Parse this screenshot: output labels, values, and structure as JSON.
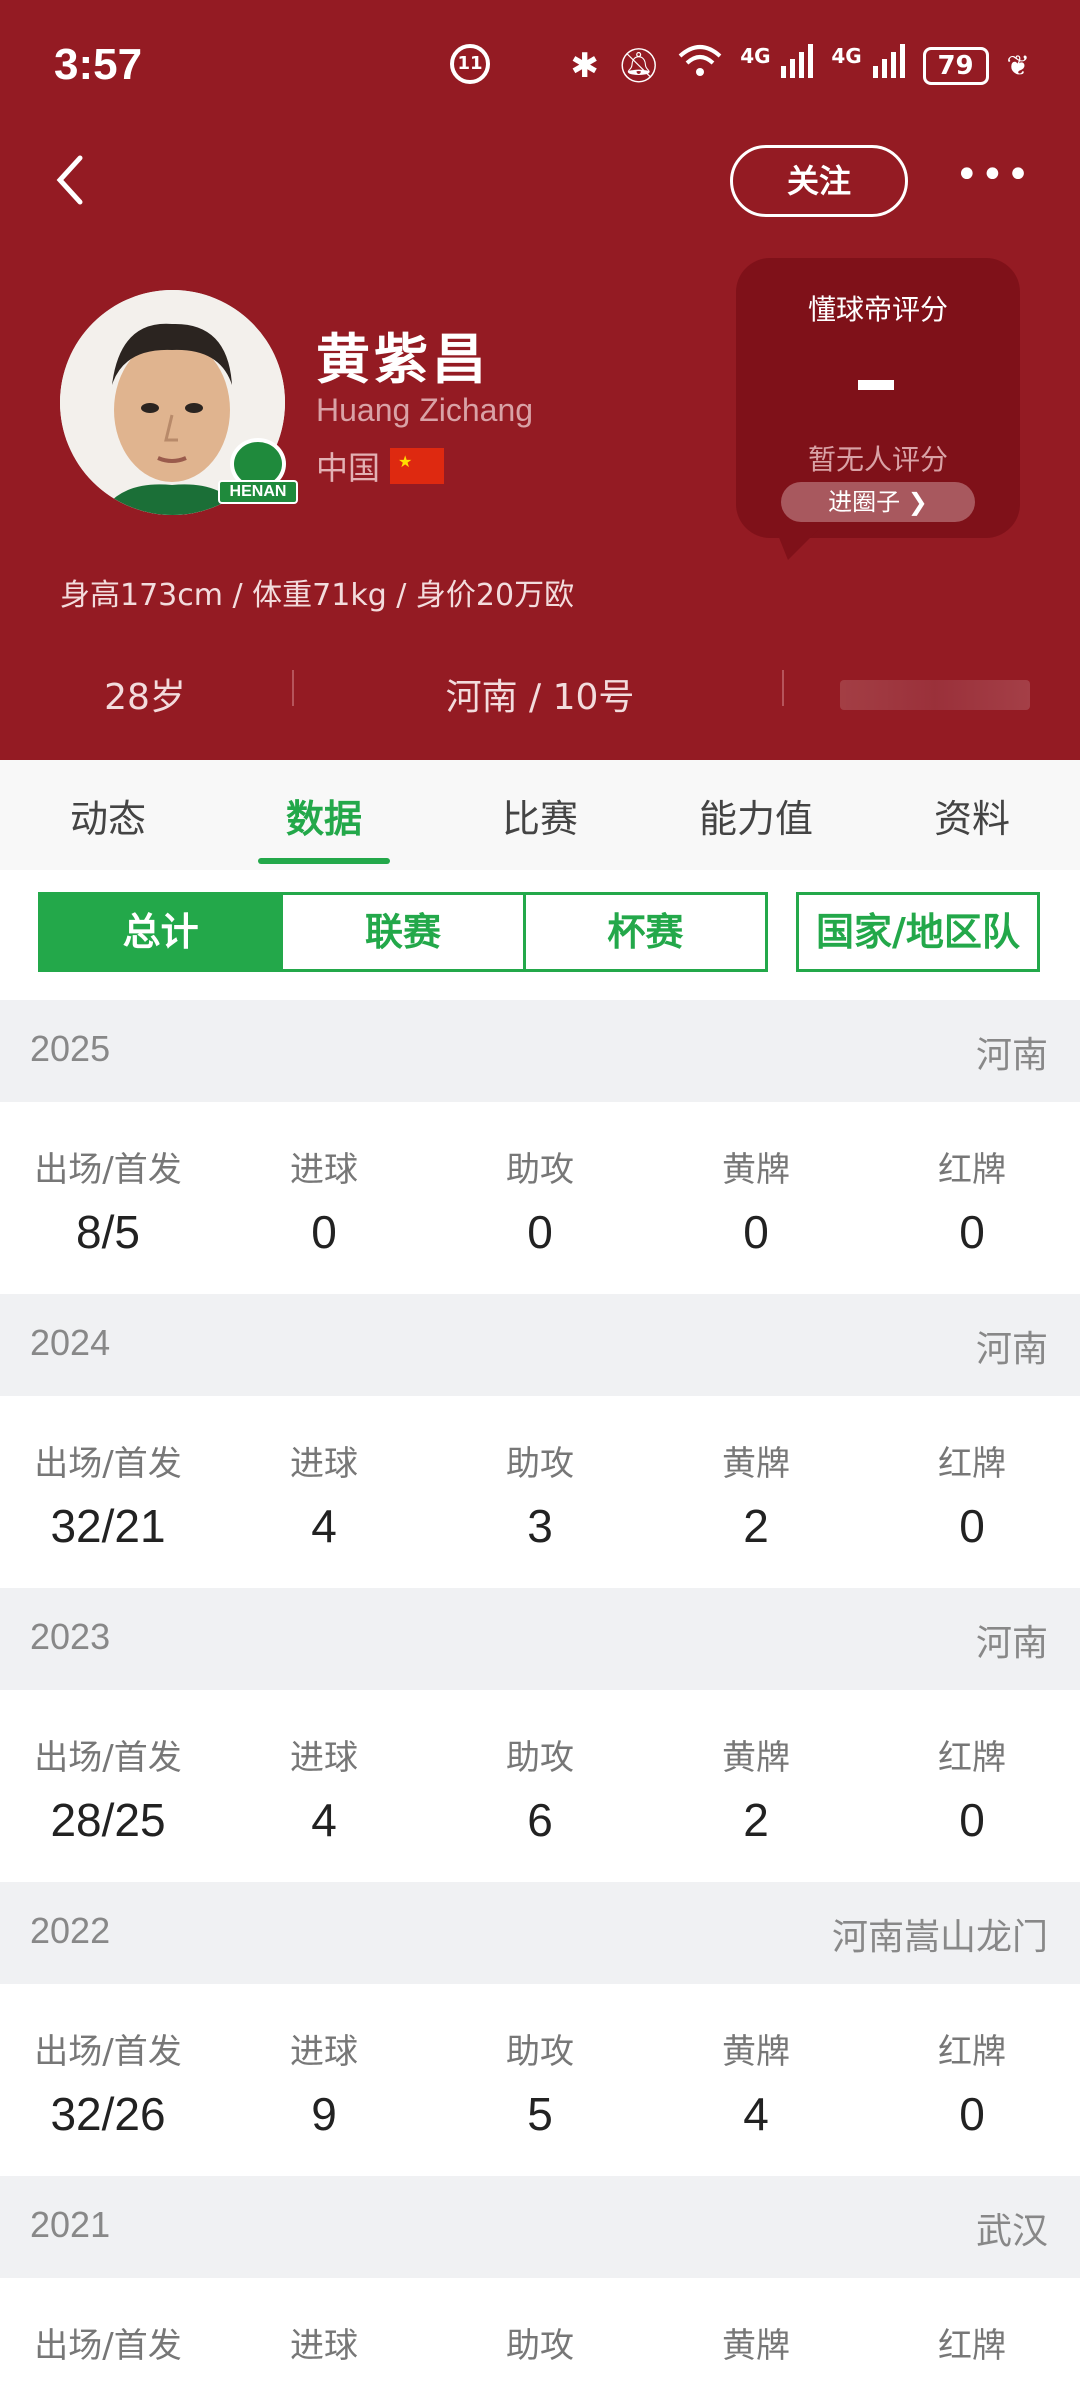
{
  "status_bar": {
    "time": "3:57",
    "battery": "79"
  },
  "header": {
    "follow_label": "关注",
    "more_label": "•••",
    "club_badge": "HENAN",
    "name_cn": "黄紫昌",
    "name_en": "Huang Zichang",
    "nation": "中国",
    "rating": {
      "title": "懂球帝评分",
      "note": "暂无人评分",
      "join": "进圈子 ❯"
    },
    "body_stats": "身高173cm / 体重71kg / 身价20万欧",
    "age": "28岁",
    "team_number": "河南 / 10号"
  },
  "tabs": [
    "动态",
    "数据",
    "比赛",
    "能力值",
    "资料"
  ],
  "active_tab": 1,
  "segments": [
    "总计",
    "联赛",
    "杯赛"
  ],
  "segment_national": "国家/地区队",
  "stat_labels": [
    "出场/首发",
    "进球",
    "助攻",
    "黄牌",
    "红牌"
  ],
  "seasons": [
    {
      "year": "2025",
      "team": "河南",
      "values": [
        "8/5",
        "0",
        "0",
        "0",
        "0"
      ]
    },
    {
      "year": "2024",
      "team": "河南",
      "values": [
        "32/21",
        "4",
        "3",
        "2",
        "0"
      ]
    },
    {
      "year": "2023",
      "team": "河南",
      "values": [
        "28/25",
        "4",
        "6",
        "2",
        "0"
      ]
    },
    {
      "year": "2022",
      "team": "河南嵩山龙门",
      "values": [
        "32/26",
        "9",
        "5",
        "4",
        "0"
      ]
    },
    {
      "year": "2021",
      "team": "武汉",
      "values": [
        "",
        "",
        "",
        "",
        ""
      ]
    }
  ],
  "colors": {
    "header_bg": "#941b23",
    "accent_green": "#23a84a"
  }
}
